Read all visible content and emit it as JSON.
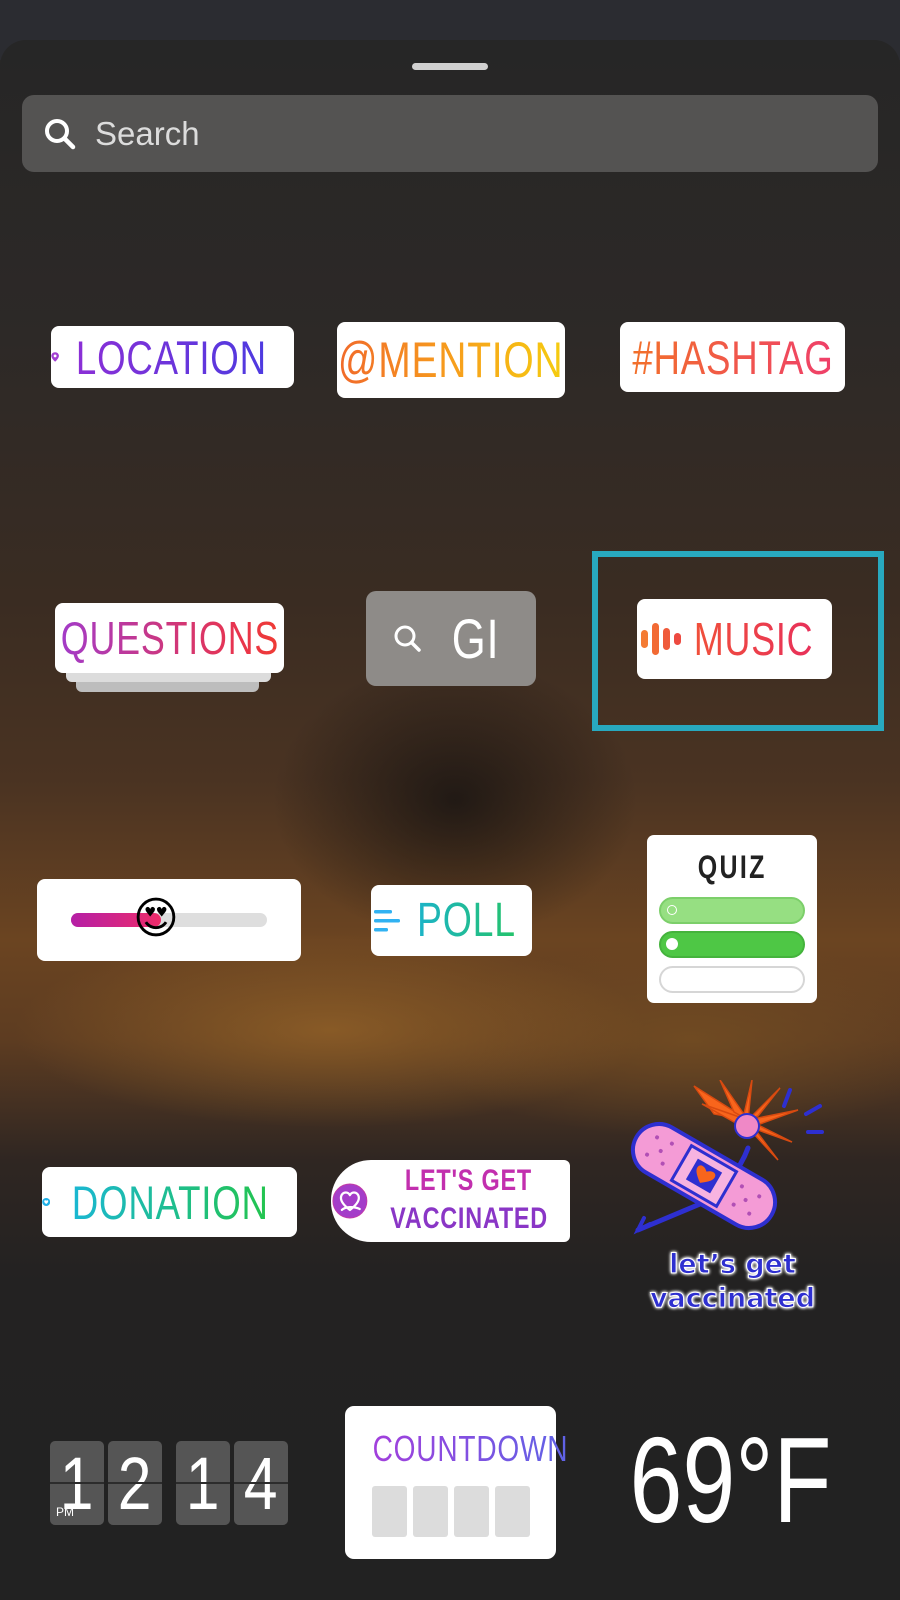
{
  "search": {
    "placeholder": "Search"
  },
  "stickers": {
    "location": "LOCATION",
    "mention": "@MENTION",
    "hashtag": "#HASHTAG",
    "questions": "QUESTIONS",
    "gif": "GI",
    "music": "MUSIC",
    "slider_emoji": "😍",
    "poll": "POLL",
    "quiz": "QUIZ",
    "donation": "DONATION",
    "vaccinated_line1": "LET'S GET",
    "vaccinated_line2": "VACCINATED",
    "vaccinated_art_line1": "let’s get",
    "vaccinated_art_line2": "vaccinated",
    "clock": {
      "period": "PM",
      "hour": [
        "1",
        "2"
      ],
      "minute": [
        "1",
        "4"
      ]
    },
    "countdown": "COUNTDOWN",
    "temperature": "69°F"
  },
  "selected": "music",
  "colors": {
    "selection": "#28a9bf",
    "sheet": "#262626",
    "search_bg": "#545352"
  }
}
